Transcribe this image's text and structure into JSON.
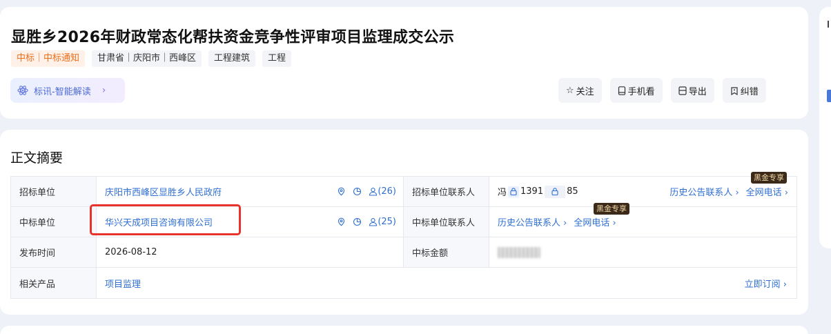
{
  "header": {
    "title": "显胜乡2026年财政常态化帮扶资金竞争性评审项目监理成交公示",
    "tags": [
      "中标｜中标通知",
      "甘肃省｜庆阳市｜西峰区",
      "工程建筑",
      "工程"
    ],
    "ai_label": "标讯-智能解读",
    "actions": {
      "follow": "关注",
      "mobile": "手机看",
      "export": "导出",
      "correct": "纠错"
    }
  },
  "summary": {
    "title": "正文摘要",
    "rows": {
      "tenderer": {
        "label": "招标单位",
        "value": "庆阳市西峰区显胜乡人民政府",
        "count": "(26)",
        "contact_label": "招标单位联系人",
        "contact_name": "冯",
        "phone_prefix": "1391",
        "phone_suffix": "85",
        "history_link": "历史公告联系人 ›",
        "web_phone_link": "全网电话 ›",
        "badge": "黑金专享"
      },
      "winner": {
        "label": "中标单位",
        "value": "华兴天成项目咨询有限公司",
        "count": "(25)",
        "contact_label": "中标单位联系人",
        "history_link": "历史公告联系人 ›",
        "web_phone_link": "全网电话 ›",
        "badge": "黑金专享"
      },
      "publish": {
        "label": "发布时间",
        "value": "2026-08-12",
        "amount_label": "中标金额"
      },
      "product": {
        "label": "相关产品",
        "value": "项目监理",
        "subscribe": "立即订阅 ›"
      }
    }
  },
  "colors": {
    "link": "#2f6fd1",
    "tag_primary": "#ee6d1b",
    "highlight": "#e8322b",
    "badge_bg": "#3b2a1a"
  }
}
